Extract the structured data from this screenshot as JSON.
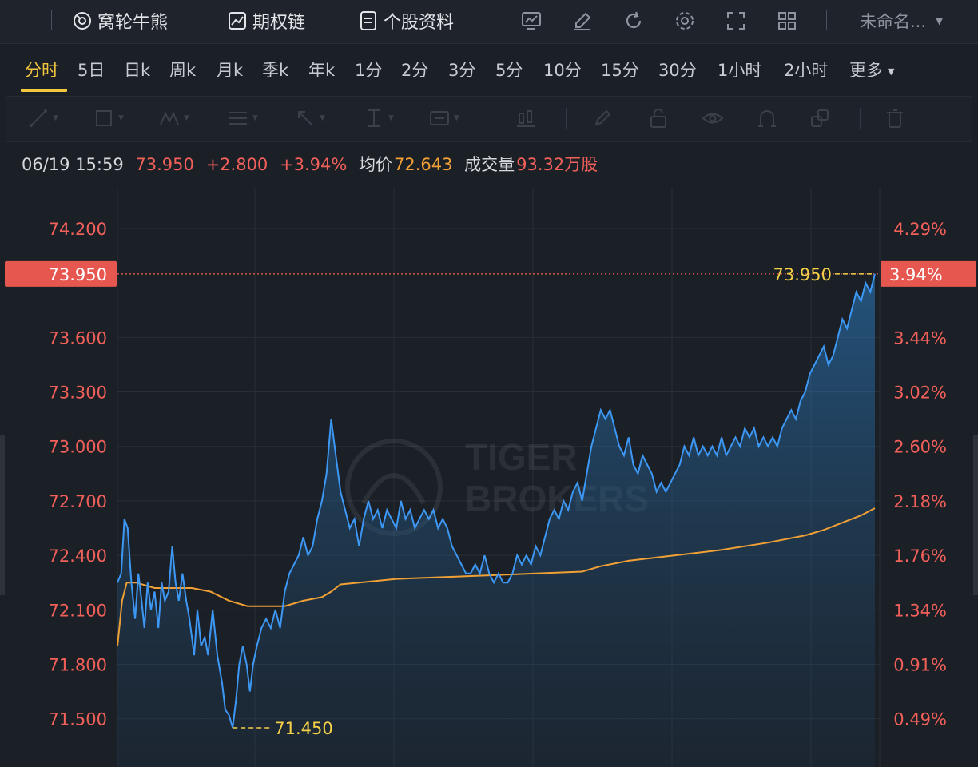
{
  "topbar": {
    "links": [
      {
        "id": "warrants",
        "label": "窝轮牛熊",
        "icon": "warrant-icon"
      },
      {
        "id": "options",
        "label": "期权链",
        "icon": "option-chain-icon"
      },
      {
        "id": "profile",
        "label": "个股资料",
        "icon": "document-icon"
      }
    ],
    "tools": [
      "chart-compare-icon",
      "pen-draw-icon",
      "refresh-icon",
      "gear-icon",
      "expand-icon",
      "grid-layout-icon"
    ],
    "layout_name": "未命名..."
  },
  "periods": [
    "分时",
    "5日",
    "日k",
    "周k",
    "月k",
    "季k",
    "年k",
    "1分",
    "2分",
    "3分",
    "5分",
    "10分",
    "15分",
    "30分",
    "1小时",
    "2小时",
    "更多"
  ],
  "active_period": "分时",
  "drawing_tools": [
    "line-tool-icon",
    "rectangle-tool-icon",
    "pattern-tool-icon",
    "fibonacci-tool-icon",
    "arrow-tool-icon",
    "text-cursor-tool-icon",
    "text-label-tool-icon",
    "candle-tool-icon",
    "brush-tool-icon",
    "lock-icon",
    "eye-icon",
    "magnet-icon",
    "layers-icon",
    "trash-icon"
  ],
  "quote": {
    "time": "06/19 15:59",
    "price": "73.950",
    "change": "+2.800",
    "change_pct": "+3.94%",
    "avg_label": "均价",
    "avg_value": "72.643",
    "volume_label": "成交量",
    "volume_value": "93.32万股"
  },
  "watermark": {
    "line1": "TIGER",
    "line2": "BROKERS"
  },
  "colors": {
    "price_line": "#3d98f5",
    "avg_line": "#f0a035",
    "axis_text": "#f2605a",
    "current_tag": "#e5574f",
    "marker": "#f3d048",
    "active": "#f3c640"
  },
  "chart_data": {
    "type": "line",
    "title": "",
    "ylim": [
      71.45,
      74.2
    ],
    "yticks": [
      "74.200",
      "73.600",
      "73.300",
      "73.000",
      "72.700",
      "72.400",
      "72.100",
      "71.800",
      "71.500"
    ],
    "pct_ticks": [
      "4.29%",
      "3.44%",
      "3.02%",
      "2.60%",
      "2.18%",
      "1.76%",
      "1.34%",
      "0.91%",
      "0.49%"
    ],
    "current_price_label": "73.950",
    "current_pct_label": "3.94%",
    "high_marker": "73.950",
    "low_marker": "71.450",
    "series": [
      {
        "id": "price",
        "points": [
          [
            0,
            72.25
          ],
          [
            0.8,
            72.3
          ],
          [
            1.5,
            72.6
          ],
          [
            2.2,
            72.55
          ],
          [
            3,
            72.25
          ],
          [
            3.8,
            72.05
          ],
          [
            4.5,
            72.3
          ],
          [
            5.2,
            72.15
          ],
          [
            5.8,
            72.0
          ],
          [
            6.5,
            72.25
          ],
          [
            7.2,
            72.1
          ],
          [
            8,
            72.2
          ],
          [
            8.8,
            72.0
          ],
          [
            9.5,
            72.25
          ],
          [
            10.2,
            72.15
          ],
          [
            11,
            72.2
          ],
          [
            11.8,
            72.45
          ],
          [
            12.5,
            72.25
          ],
          [
            13.2,
            72.15
          ],
          [
            14,
            72.3
          ],
          [
            14.8,
            72.15
          ],
          [
            15.5,
            72.05
          ],
          [
            16,
            71.95
          ],
          [
            16.5,
            71.85
          ],
          [
            17.2,
            72.1
          ],
          [
            18,
            71.9
          ],
          [
            18.8,
            71.95
          ],
          [
            19.5,
            71.85
          ],
          [
            20.5,
            72.1
          ],
          [
            21.5,
            71.85
          ],
          [
            22.5,
            71.7
          ],
          [
            23.2,
            71.55
          ],
          [
            24,
            71.52
          ],
          [
            24.8,
            71.45
          ],
          [
            25.5,
            71.6
          ],
          [
            26.2,
            71.8
          ],
          [
            27,
            71.9
          ],
          [
            27.8,
            71.8
          ],
          [
            28.5,
            71.65
          ],
          [
            29.2,
            71.8
          ],
          [
            30,
            71.9
          ],
          [
            31,
            72.0
          ],
          [
            32,
            72.05
          ],
          [
            33,
            72.0
          ],
          [
            34,
            72.1
          ],
          [
            35,
            72.0
          ],
          [
            36,
            72.2
          ],
          [
            37,
            72.3
          ],
          [
            38,
            72.35
          ],
          [
            39,
            72.4
          ],
          [
            40,
            72.5
          ],
          [
            41,
            72.4
          ],
          [
            42,
            72.45
          ],
          [
            43,
            72.6
          ],
          [
            44,
            72.7
          ],
          [
            45,
            72.85
          ],
          [
            46,
            73.15
          ],
          [
            47,
            72.95
          ],
          [
            48,
            72.75
          ],
          [
            49,
            72.65
          ],
          [
            50,
            72.55
          ],
          [
            51,
            72.6
          ],
          [
            52,
            72.45
          ],
          [
            53,
            72.6
          ],
          [
            54,
            72.7
          ],
          [
            55,
            72.6
          ],
          [
            56,
            72.65
          ],
          [
            57,
            72.55
          ],
          [
            58,
            72.65
          ],
          [
            59,
            72.6
          ],
          [
            60,
            72.55
          ],
          [
            61,
            72.7
          ],
          [
            62,
            72.6
          ],
          [
            63,
            72.65
          ],
          [
            64,
            72.55
          ],
          [
            65,
            72.6
          ],
          [
            66,
            72.65
          ],
          [
            67,
            72.6
          ],
          [
            68,
            72.65
          ],
          [
            69,
            72.55
          ],
          [
            70,
            72.6
          ],
          [
            71,
            72.55
          ],
          [
            72,
            72.45
          ],
          [
            73,
            72.4
          ],
          [
            74,
            72.35
          ],
          [
            75,
            72.3
          ],
          [
            76,
            72.3
          ],
          [
            77,
            72.35
          ],
          [
            78,
            72.3
          ],
          [
            79,
            72.4
          ],
          [
            80,
            72.3
          ],
          [
            81,
            72.25
          ],
          [
            82,
            72.3
          ],
          [
            83,
            72.25
          ],
          [
            84,
            72.25
          ],
          [
            85,
            72.3
          ],
          [
            86,
            72.4
          ],
          [
            87,
            72.35
          ],
          [
            88,
            72.4
          ],
          [
            89,
            72.35
          ],
          [
            90,
            72.45
          ],
          [
            91,
            72.4
          ],
          [
            92,
            72.5
          ],
          [
            93,
            72.6
          ],
          [
            94,
            72.65
          ],
          [
            95,
            72.6
          ],
          [
            96,
            72.7
          ],
          [
            97,
            72.65
          ],
          [
            98,
            72.75
          ],
          [
            99,
            72.8
          ],
          [
            100,
            72.7
          ],
          [
            101,
            72.85
          ],
          [
            102,
            73.0
          ],
          [
            103,
            73.1
          ],
          [
            104,
            73.2
          ],
          [
            105,
            73.15
          ],
          [
            106,
            73.2
          ],
          [
            107,
            73.1
          ],
          [
            108,
            73.0
          ],
          [
            109,
            72.95
          ],
          [
            110,
            73.05
          ],
          [
            111,
            72.9
          ],
          [
            112,
            72.85
          ],
          [
            113,
            72.95
          ],
          [
            114,
            72.9
          ],
          [
            115,
            72.85
          ],
          [
            116,
            72.75
          ],
          [
            117,
            72.8
          ],
          [
            118,
            72.75
          ],
          [
            119,
            72.8
          ],
          [
            120,
            72.85
          ],
          [
            121,
            72.9
          ],
          [
            122,
            73.0
          ],
          [
            123,
            72.95
          ],
          [
            124,
            73.05
          ],
          [
            125,
            72.95
          ],
          [
            126,
            73.0
          ],
          [
            127,
            72.95
          ],
          [
            128,
            73.0
          ],
          [
            129,
            72.95
          ],
          [
            130,
            73.05
          ],
          [
            131,
            72.95
          ],
          [
            132,
            73.0
          ],
          [
            133,
            73.05
          ],
          [
            134,
            73.0
          ],
          [
            135,
            73.1
          ],
          [
            136,
            73.05
          ],
          [
            137,
            73.1
          ],
          [
            138,
            73.0
          ],
          [
            139,
            73.05
          ],
          [
            140,
            73.0
          ],
          [
            141,
            73.05
          ],
          [
            142,
            73.0
          ],
          [
            143,
            73.1
          ],
          [
            144,
            73.15
          ],
          [
            145,
            73.2
          ],
          [
            146,
            73.15
          ],
          [
            147,
            73.25
          ],
          [
            148,
            73.3
          ],
          [
            149,
            73.4
          ],
          [
            150,
            73.45
          ],
          [
            151,
            73.5
          ],
          [
            152,
            73.55
          ],
          [
            153,
            73.45
          ],
          [
            154,
            73.5
          ],
          [
            155,
            73.6
          ],
          [
            156,
            73.7
          ],
          [
            157,
            73.65
          ],
          [
            158,
            73.75
          ],
          [
            159,
            73.85
          ],
          [
            160,
            73.8
          ],
          [
            161,
            73.9
          ],
          [
            162,
            73.85
          ],
          [
            163,
            73.95
          ]
        ]
      },
      {
        "id": "average",
        "points": [
          [
            0,
            71.9
          ],
          [
            1,
            72.15
          ],
          [
            2,
            72.25
          ],
          [
            4,
            72.25
          ],
          [
            8,
            72.22
          ],
          [
            12,
            72.22
          ],
          [
            16,
            72.22
          ],
          [
            20,
            72.2
          ],
          [
            24,
            72.15
          ],
          [
            28,
            72.12
          ],
          [
            32,
            72.12
          ],
          [
            36,
            72.12
          ],
          [
            40,
            72.15
          ],
          [
            44,
            72.17
          ],
          [
            46,
            72.2
          ],
          [
            48,
            72.24
          ],
          [
            52,
            72.25
          ],
          [
            60,
            72.27
          ],
          [
            70,
            72.28
          ],
          [
            80,
            72.29
          ],
          [
            90,
            72.3
          ],
          [
            100,
            72.31
          ],
          [
            104,
            72.34
          ],
          [
            110,
            72.37
          ],
          [
            120,
            72.4
          ],
          [
            130,
            72.43
          ],
          [
            140,
            72.47
          ],
          [
            148,
            72.51
          ],
          [
            152,
            72.54
          ],
          [
            156,
            72.58
          ],
          [
            160,
            72.62
          ],
          [
            163,
            72.66
          ]
        ]
      }
    ]
  }
}
